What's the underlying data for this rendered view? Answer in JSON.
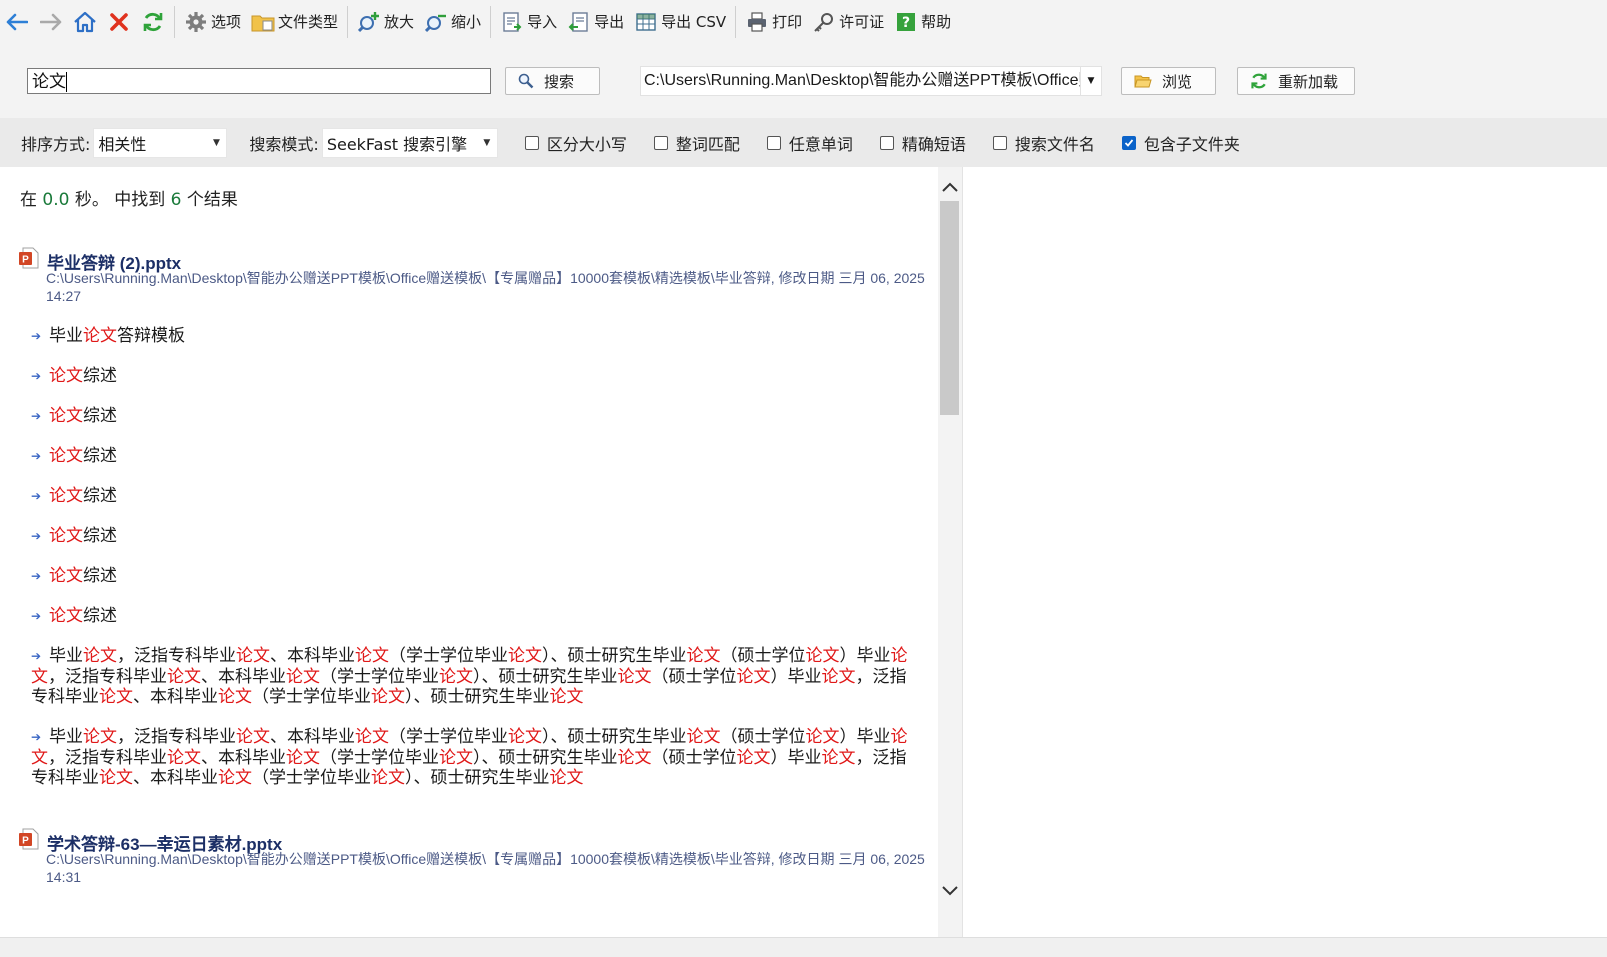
{
  "toolbar": {
    "back_label": "",
    "options": "选项",
    "file_types": "文件类型",
    "zoom_in": "放大",
    "zoom_out": "缩小",
    "import": "导入",
    "export": "导出",
    "export_csv": "导出 CSV",
    "print": "打印",
    "license": "许可证",
    "help": "帮助"
  },
  "search": {
    "query": "论文",
    "search_button": "搜索",
    "path": "C:\\Users\\Running.Man\\Desktop\\智能办公赠送PPT模板\\Office赠送模板\\【专属赠品】10000套模板\\精选模板\\毕业答辩",
    "browse_button": "浏览",
    "reload_button": "重新加载"
  },
  "options": {
    "sort_label": "排序方式:",
    "sort_value": "相关性",
    "mode_label": "搜索模式:",
    "mode_value": "SeekFast 搜索引擎",
    "checkboxes": [
      {
        "label": "区分大小写",
        "checked": false
      },
      {
        "label": "整词匹配",
        "checked": false
      },
      {
        "label": "任意单词",
        "checked": false
      },
      {
        "label": "精确短语",
        "checked": false
      },
      {
        "label": "搜索文件名",
        "checked": false
      },
      {
        "label": "包含子文件夹",
        "checked": true
      }
    ]
  },
  "summary": {
    "prefix": "在",
    "seconds": "0.0",
    "mid": "秒。 中找到",
    "count": "6",
    "suffix": "个结果"
  },
  "results": [
    {
      "title": "毕业答辩 (2).pptx",
      "path": "C:\\Users\\Running.Man\\Desktop\\智能办公赠送PPT模板\\Office赠送模板\\【专属赠品】10000套模板\\精选模板\\毕业答辩, 修改日期 三月 06, 2025 14:27",
      "hits": [
        "毕业[论文]答辩模板",
        "[论文]综述",
        "[论文]综述",
        "[论文]综述",
        "[论文]综述",
        "[论文]综述",
        "[论文]综述",
        "[论文]综述",
        "毕业[论文]，泛指专科毕业[论文]、本科毕业[论文]（学士学位毕业[论文]）、硕士研究生毕业[论文]（硕士学位[论文]）毕业[论文]，泛指专科毕业[论文]、本科毕业[论文]（学士学位毕业[论文]）、硕士研究生毕业[论文]（硕士学位[论文]）毕业[论文]，泛指专科毕业[论文]、本科毕业[论文]（学士学位毕业[论文]）、硕士研究生毕业[论文]",
        "毕业[论文]，泛指专科毕业[论文]、本科毕业[论文]（学士学位毕业[论文]）、硕士研究生毕业[论文]（硕士学位[论文]）毕业[论文]，泛指专科毕业[论文]、本科毕业[论文]（学士学位毕业[论文]）、硕士研究生毕业[论文]（硕士学位[论文]）毕业[论文]，泛指专科毕业[论文]、本科毕业[论文]（学士学位毕业[论文]）、硕士研究生毕业[论文]"
      ]
    },
    {
      "title": "学术答辩-63—幸运日素材.pptx",
      "path": "C:\\Users\\Running.Man\\Desktop\\智能办公赠送PPT模板\\Office赠送模板\\【专属赠品】10000套模板\\精选模板\\毕业答辩, 修改日期 三月 06, 2025 14:31",
      "hits": []
    }
  ],
  "colors": {
    "highlight": "#e01818",
    "title": "#1c2f66",
    "path": "#4c5a86",
    "count": "#1a7a3a"
  }
}
